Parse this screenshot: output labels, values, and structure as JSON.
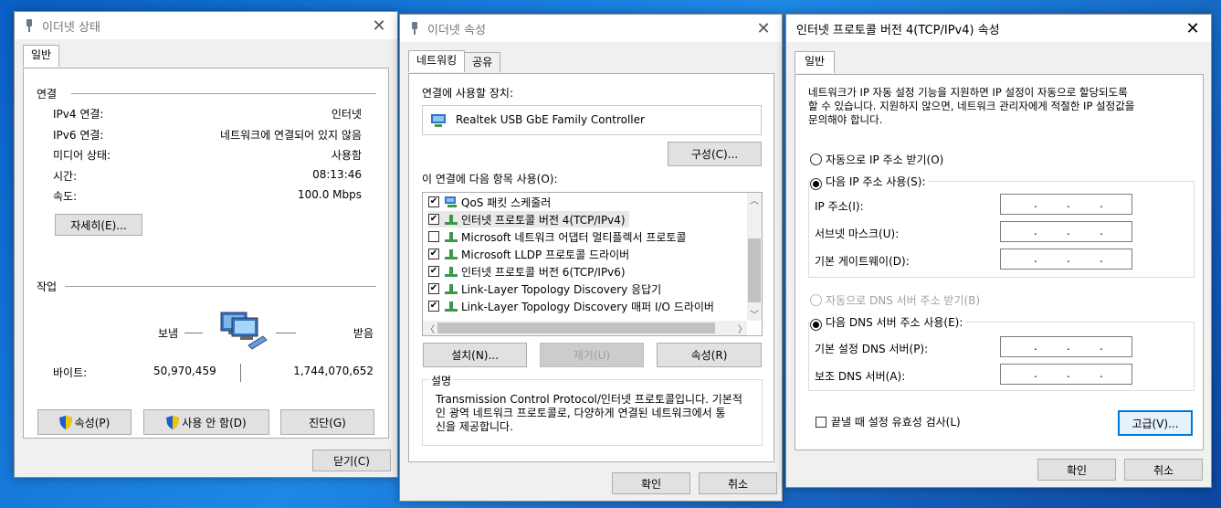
{
  "status_window": {
    "title": "이더넷 상태",
    "tab": "일반",
    "connection_group": "연결",
    "rows": [
      {
        "label": "IPv4 연결:",
        "value": "인터넷"
      },
      {
        "label": "IPv6 연결:",
        "value": "네트워크에 연결되어 있지 않음"
      },
      {
        "label": "미디어 상태:",
        "value": "사용함"
      },
      {
        "label": "시간:",
        "value": "08:13:46"
      },
      {
        "label": "속도:",
        "value": "100.0 Mbps"
      }
    ],
    "details_button": "자세히(E)...",
    "activity_group": "작업",
    "sent_label": "보냄",
    "received_label": "받음",
    "bytes_label": "바이트:",
    "bytes_sent": "50,970,459",
    "bytes_received": "1,744,070,652",
    "properties_button": "속성(P)",
    "disable_button": "사용 안 함(D)",
    "diagnose_button": "진단(G)",
    "close_button": "닫기(C)"
  },
  "props_window": {
    "title": "이더넷 속성",
    "tabs": [
      "네트워킹",
      "공유"
    ],
    "connect_using_label": "연결에 사용할 장치:",
    "adapter_name": "Realtek USB GbE Family Controller",
    "configure_button": "구성(C)...",
    "items_label": "이 연결에 다음 항목 사용(O):",
    "items": [
      {
        "label": "QoS 패킷 스케줄러",
        "checked": true
      },
      {
        "label": "인터넷 프로토콜 버전 4(TCP/IPv4)",
        "checked": true
      },
      {
        "label": "Microsoft 네트워크 어댑터 멀티플렉서 프로토콜",
        "checked": false
      },
      {
        "label": "Microsoft LLDP 프로토콜 드라이버",
        "checked": true
      },
      {
        "label": "인터넷 프로토콜 버전 6(TCP/IPv6)",
        "checked": true
      },
      {
        "label": "Link-Layer Topology Discovery 응답기",
        "checked": true
      },
      {
        "label": "Link-Layer Topology Discovery 매퍼 I/O 드라이버",
        "checked": true
      }
    ],
    "install_button": "설치(N)...",
    "uninstall_button": "제거(U)",
    "properties_button": "속성(R)",
    "description_group": "설명",
    "description_lines": [
      "Transmission Control Protocol/인터넷 프로토콜입니다. 기본적",
      "인 광역 네트워크 프로토콜로, 다양하게 연결된 네트워크에서 통",
      "신을 제공합니다."
    ],
    "ok_button": "확인",
    "cancel_button": "취소"
  },
  "ipv4_window": {
    "title": "인터넷 프로토콜 버전 4(TCP/IPv4) 속성",
    "tab": "일반",
    "intro_lines": [
      "네트워크가 IP 자동 설정 기능을 지원하면 IP 설정이 자동으로 할당되도록",
      "할 수 있습니다. 지원하지 않으면, 네트워크 관리자에게 적절한 IP 설정값을",
      "문의해야 합니다."
    ],
    "auto_ip_label": "자동으로 IP 주소 받기(O)",
    "manual_ip_label": "다음 IP 주소 사용(S):",
    "ip_label": "IP 주소(I):",
    "subnet_label": "서브넷 마스크(U):",
    "gateway_label": "기본 게이트웨이(D):",
    "auto_dns_label": "자동으로 DNS 서버 주소 받기(B)",
    "manual_dns_label": "다음 DNS 서버 주소 사용(E):",
    "preferred_dns_label": "기본 설정 DNS 서버(P):",
    "alternate_dns_label": "보조 DNS 서버(A):",
    "validate_label": "끝낼 때 설정 유효성 검사(L)",
    "advanced_button": "고급(V)...",
    "ok_button": "확인",
    "cancel_button": "취소"
  },
  "colors": {
    "accent": "#0078d7",
    "desktop": "#1e88e5"
  }
}
